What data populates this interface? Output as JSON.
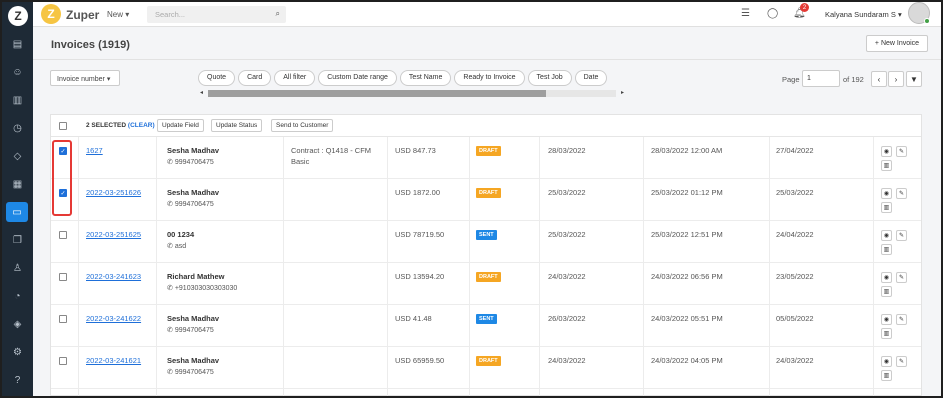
{
  "app": {
    "brand": "Zuper",
    "new_menu": "New",
    "search_placeholder": "Search...",
    "notification_count": "2",
    "user_name": "Kalyana Sundaram S"
  },
  "page": {
    "title": "Invoices (1919)",
    "new_button": "+  New Invoice",
    "sort_label": "Invoice number"
  },
  "filters": [
    "Quote",
    "Card",
    "All filter",
    "Custom Date range",
    "Test Name",
    "Ready to Invoice",
    "Test Job",
    "Date"
  ],
  "pager": {
    "label": "Page",
    "current": "1",
    "of": "of 192"
  },
  "selection": {
    "count_text": "2 SELECTED",
    "clear": "(CLEAR)",
    "actions": [
      "Update Field",
      "Update Status",
      "Send to Customer"
    ]
  },
  "rows": [
    {
      "checked": true,
      "number": "1627",
      "customer": "Sesha Madhav",
      "phone": "9994706475",
      "contract": "Contract : Q1418 - CFM",
      "contract2": "Basic",
      "amount": "USD 847.73",
      "status": "DRAFT",
      "date1": "28/03/2022",
      "date2": "28/03/2022 12:00 AM",
      "date3": "27/04/2022"
    },
    {
      "checked": true,
      "number": "2022-03-251626",
      "customer": "Sesha Madhav",
      "phone": "9994706475",
      "contract": "",
      "contract2": "",
      "amount": "USD 1872.00",
      "status": "DRAFT",
      "date1": "25/03/2022",
      "date2": "25/03/2022 01:12 PM",
      "date3": "25/03/2022"
    },
    {
      "checked": false,
      "number": "2022-03-251625",
      "customer": "00 1234",
      "phone": "asd",
      "contract": "",
      "contract2": "",
      "amount": "USD 78719.50",
      "status": "SENT",
      "date1": "25/03/2022",
      "date2": "25/03/2022 12:51 PM",
      "date3": "24/04/2022"
    },
    {
      "checked": false,
      "number": "2022-03-241623",
      "customer": "Richard Mathew",
      "phone": "+910303030303030",
      "contract": "",
      "contract2": "",
      "amount": "USD 13594.20",
      "status": "DRAFT",
      "date1": "24/03/2022",
      "date2": "24/03/2022 06:56 PM",
      "date3": "23/05/2022"
    },
    {
      "checked": false,
      "number": "2022-03-241622",
      "customer": "Sesha Madhav",
      "phone": "9994706475",
      "contract": "",
      "contract2": "",
      "amount": "USD 41.48",
      "status": "SENT",
      "date1": "26/03/2022",
      "date2": "24/03/2022 05:51 PM",
      "date3": "05/05/2022"
    },
    {
      "checked": false,
      "number": "2022-03-241621",
      "customer": "Sesha Madhav",
      "phone": "9994706475",
      "contract": "",
      "contract2": "",
      "amount": "USD 65959.50",
      "status": "DRAFT",
      "date1": "24/03/2022",
      "date2": "24/03/2022 04:05 PM",
      "date3": "24/03/2022"
    }
  ],
  "colors": {
    "sidebar": "#1e2a36",
    "accent": "#1e6fd9",
    "draft": "#f5a623",
    "sent": "#1e88e5",
    "highlight": "#e53935"
  }
}
